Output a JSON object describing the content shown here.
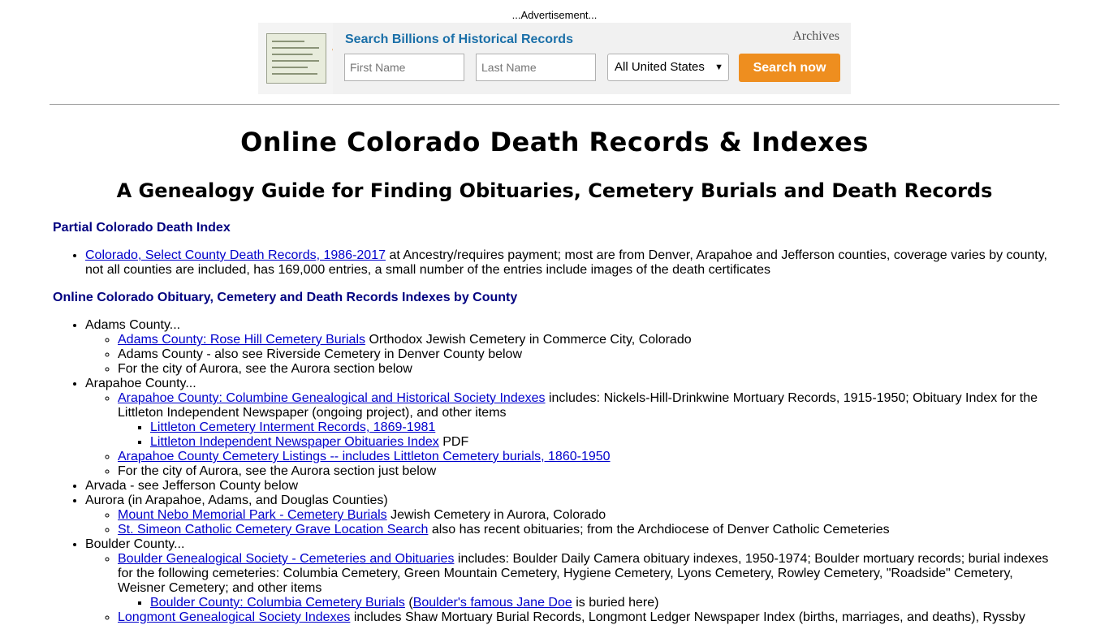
{
  "ad": {
    "label": "...Advertisement...",
    "headline": "Search Billions of Historical Records",
    "brand": "Archives",
    "first_name_placeholder": "First Name",
    "last_name_placeholder": "Last Name",
    "location_value": "All United States",
    "search_button": "Search now"
  },
  "page": {
    "title": "Online Colorado Death Records & Indexes",
    "subtitle": "A Genealogy Guide for Finding Obituaries, Cemetery Burials and Death Records"
  },
  "sections": {
    "partial": {
      "heading": "Partial Colorado Death Index",
      "item1_link": "Colorado, Select County Death Records, 1986-2017",
      "item1_text": " at Ancestry/requires payment; most are from Denver, Arapahoe and Jefferson counties, coverage varies by county, not all counties are included, has 169,000 entries, a small number of the entries include images of the death certificates"
    },
    "county": {
      "heading": "Online Colorado Obituary, Cemetery and Death Records Indexes by County",
      "adams": {
        "label": "Adams County...",
        "rose_hill_link": "Adams County: Rose Hill Cemetery Burials",
        "rose_hill_text": " Orthodox Jewish Cemetery in Commerce City, Colorado",
        "riverside": "Adams County - also see Riverside Cemetery in Denver County below",
        "aurora": "For the city of Aurora, see the Aurora section below"
      },
      "arapahoe": {
        "label": "Arapahoe County...",
        "columbine_link": "Arapahoe County: Columbine Genealogical and Historical Society Indexes",
        "columbine_text": " includes: Nickels-Hill-Drinkwine Mortuary Records, 1915-1950; Obituary Index for the Littleton Independent Newspaper (ongoing project), and other items",
        "littleton_cem_link": "Littleton Cemetery Interment Records, 1869-1981",
        "littleton_news_link": "Littleton Independent Newspaper Obituaries Index",
        "littleton_news_text": " PDF",
        "listings_link": "Arapahoe County Cemetery Listings -- includes Littleton Cemetery burials, 1860-1950",
        "aurora": "For the city of Aurora, see the Aurora section just below"
      },
      "arvada": "Arvada - see Jefferson County below",
      "aurora": {
        "label": "Aurora (in Arapahoe, Adams, and Douglas Counties)",
        "nebo_link": "Mount Nebo Memorial Park - Cemetery Burials",
        "nebo_text": " Jewish Cemetery in Aurora, Colorado",
        "simeon_link": "St. Simeon Catholic Cemetery Grave Location Search",
        "simeon_text": " also has recent obituaries; from the Archdiocese of Denver Catholic Cemeteries"
      },
      "boulder": {
        "label": "Boulder County...",
        "bgs_link": "Boulder Genealogical Society - Cemeteries and Obituaries",
        "bgs_text": " includes: Boulder Daily Camera obituary indexes, 1950-1974; Boulder mortuary records; burial indexes for the following cemeteries: Columbia Cemetery, Green Mountain Cemetery, Hygiene Cemetery, Lyons Cemetery, Rowley Cemetery, \"Roadside\" Cemetery, Weisner Cemetery; and other items",
        "columbia_link": "Boulder County: Columbia Cemetery Burials",
        "columbia_open": " (",
        "jane_doe_link": "Boulder's famous Jane Doe",
        "columbia_close": " is buried here)",
        "longmont_link": "Longmont Genealogical Society Indexes",
        "longmont_text": " includes Shaw Mortuary Burial Records, Longmont Ledger Newspaper Index (births, marriages, and deaths), Ryssby"
      }
    }
  }
}
